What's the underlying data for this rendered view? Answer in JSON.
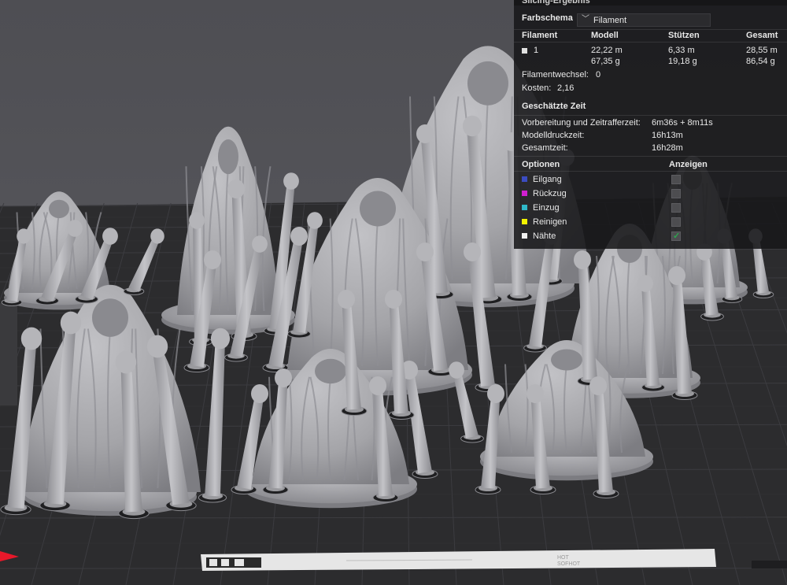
{
  "panel": {
    "title": "Slicing-Ergebnis",
    "color_scheme_label": "Farbschema",
    "color_scheme_value": "Filament",
    "columns": [
      "Filament",
      "Modell",
      "Stützen",
      "Gesamt"
    ],
    "filament_row": {
      "id": "1",
      "modell_length": "22,22 m",
      "modell_weight": "67,35 g",
      "stuetzen_length": "6,33 m",
      "stuetzen_weight": "19,18 g",
      "gesamt_length": "28,55 m",
      "gesamt_weight": "86,54 g"
    },
    "filament_changes_label": "Filamentwechsel:",
    "filament_changes_value": "0",
    "cost_label": "Kosten:",
    "cost_value": "2,16",
    "time_heading": "Geschätzte Zeit",
    "time_rows": [
      {
        "label": "Vorbereitung und Zeitrafferzeit:",
        "value": "6m36s + 8m11s"
      },
      {
        "label": "Modelldruckzeit:",
        "value": "16h13m"
      },
      {
        "label": "Gesamtzeit:",
        "value": "16h28m"
      }
    ],
    "options_heading": "Optionen",
    "show_heading": "Anzeigen",
    "options": [
      {
        "label": "Eilgang",
        "color": "#3b4cc0",
        "checked": false
      },
      {
        "label": "Rückzug",
        "color": "#d01fd0",
        "checked": false
      },
      {
        "label": "Einzug",
        "color": "#2fb7c8",
        "checked": false
      },
      {
        "label": "Reinigen",
        "color": "#f2f200",
        "checked": false
      },
      {
        "label": "Nähte",
        "color": "#f0f0f0",
        "checked": true
      }
    ]
  },
  "colors": {
    "background": "#5b5b60",
    "bed": "#2c2c2e",
    "grid_line": "#3a3a3d",
    "model_gray": "#a9a9ad",
    "accent_green": "#2ea44f",
    "nozzle_marker": "#e8182a"
  },
  "bed_bar": {
    "left_text": "HOT",
    "right_text": "SOFHOT"
  }
}
